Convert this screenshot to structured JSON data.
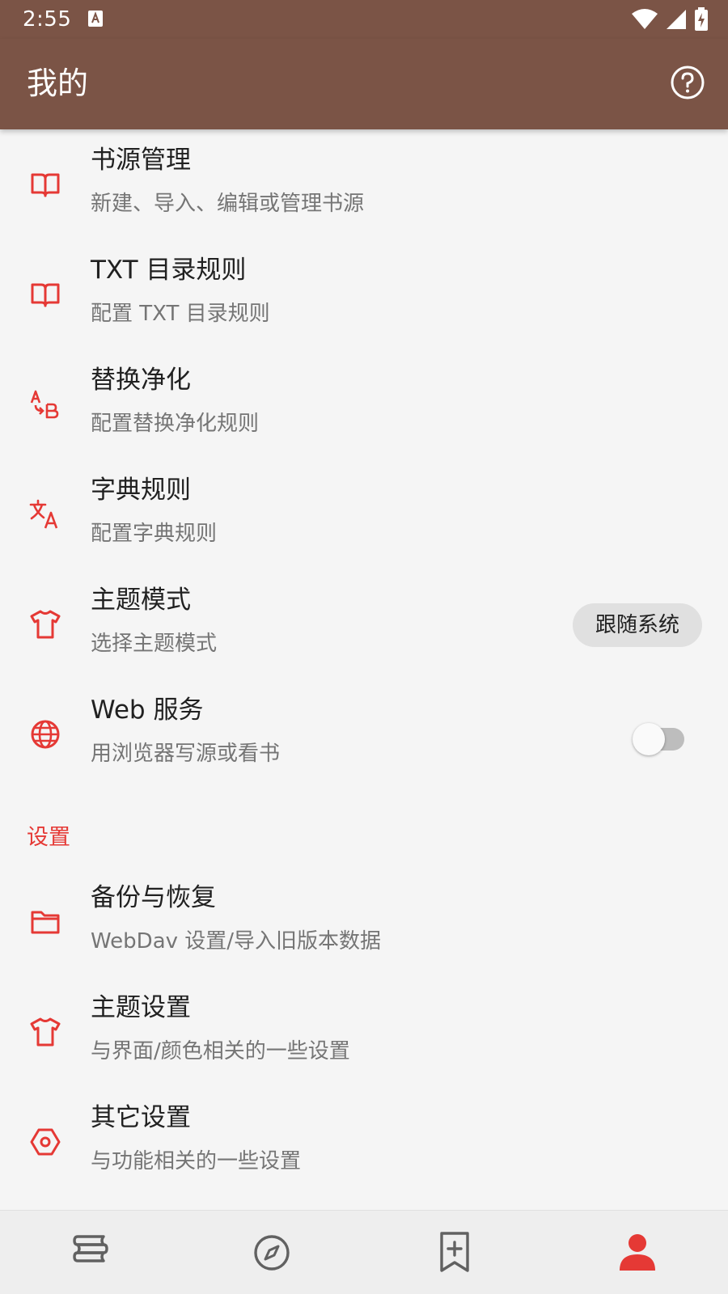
{
  "status_bar": {
    "time": "2:55"
  },
  "app_bar": {
    "title": "我的"
  },
  "items": [
    {
      "title": "书源管理",
      "subtitle": "新建、导入、编辑或管理书源",
      "icon": "book-open-icon"
    },
    {
      "title": "TXT 目录规则",
      "subtitle": "配置 TXT 目录规则",
      "icon": "book-open-icon"
    },
    {
      "title": "替换净化",
      "subtitle": "配置替换净化规则",
      "icon": "a-to-b-icon"
    },
    {
      "title": "字典规则",
      "subtitle": "配置字典规则",
      "icon": "translate-icon"
    },
    {
      "title": "主题模式",
      "subtitle": "选择主题模式",
      "icon": "tshirt-icon",
      "value": "跟随系统"
    },
    {
      "title": "Web 服务",
      "subtitle": "用浏览器写源或看书",
      "icon": "globe-icon",
      "switch_on": false
    }
  ],
  "settings_section": {
    "header": "设置",
    "items": [
      {
        "title": "备份与恢复",
        "subtitle": "WebDav 设置/导入旧版本数据",
        "icon": "folder-icon"
      },
      {
        "title": "主题设置",
        "subtitle": "与界面/颜色相关的一些设置",
        "icon": "tshirt-icon"
      },
      {
        "title": "其它设置",
        "subtitle": "与功能相关的一些设置",
        "icon": "hexagon-settings-icon"
      }
    ]
  },
  "bottom_nav": {
    "items": [
      {
        "icon": "bookshelf-icon",
        "active": false
      },
      {
        "icon": "compass-icon",
        "active": false
      },
      {
        "icon": "bookmark-add-icon",
        "active": false
      },
      {
        "icon": "person-icon",
        "active": true
      }
    ]
  },
  "colors": {
    "primary": "#7b5446",
    "accent": "#e53935",
    "background": "#f5f5f5",
    "nav_background": "#eeeeee",
    "text_primary": "#212121",
    "text_secondary": "#757575",
    "icon_inactive": "#616161"
  }
}
